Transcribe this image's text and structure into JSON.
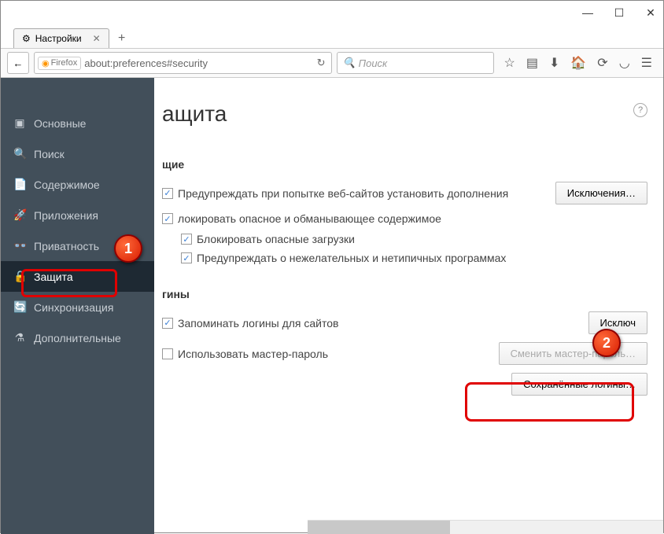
{
  "window": {
    "tab_title": "Настройки",
    "url": "about:preferences#security",
    "identity_label": "Firefox",
    "search_placeholder": "Поиск"
  },
  "sidebar": {
    "items": [
      {
        "icon": "▣",
        "label": "Основные"
      },
      {
        "icon": "🔍",
        "label": "Поиск"
      },
      {
        "icon": "📄",
        "label": "Содержимое"
      },
      {
        "icon": "🚀",
        "label": "Приложения"
      },
      {
        "icon": "👓",
        "label": "Приватность"
      },
      {
        "icon": "🔒",
        "label": "Защита"
      },
      {
        "icon": "🔄",
        "label": "Синхронизация"
      },
      {
        "icon": "⚗",
        "label": "Дополнительные"
      }
    ]
  },
  "main": {
    "title_visible": "ащита",
    "sections": {
      "general": {
        "heading_visible": "щие",
        "warn_install": "Предупреждать при попытке веб-сайтов установить дополнения",
        "exceptions_btn": "Исключения…",
        "block_dangerous": "локировать опасное и обманывающее содержимое",
        "block_downloads": "Блокировать опасные загрузки",
        "warn_unwanted": "Предупреждать о нежелательных и нетипичных программах"
      },
      "logins": {
        "heading_visible": "гины",
        "remember": "Запоминать логины для сайтов",
        "exceptions_visible": "Исключ",
        "use_master": "Использовать мастер-пароль",
        "change_master": "Сменить мастер-пароль…",
        "saved_logins": "Сохранённые логины…"
      }
    }
  },
  "annotations": {
    "n1": "1",
    "n2": "2"
  }
}
